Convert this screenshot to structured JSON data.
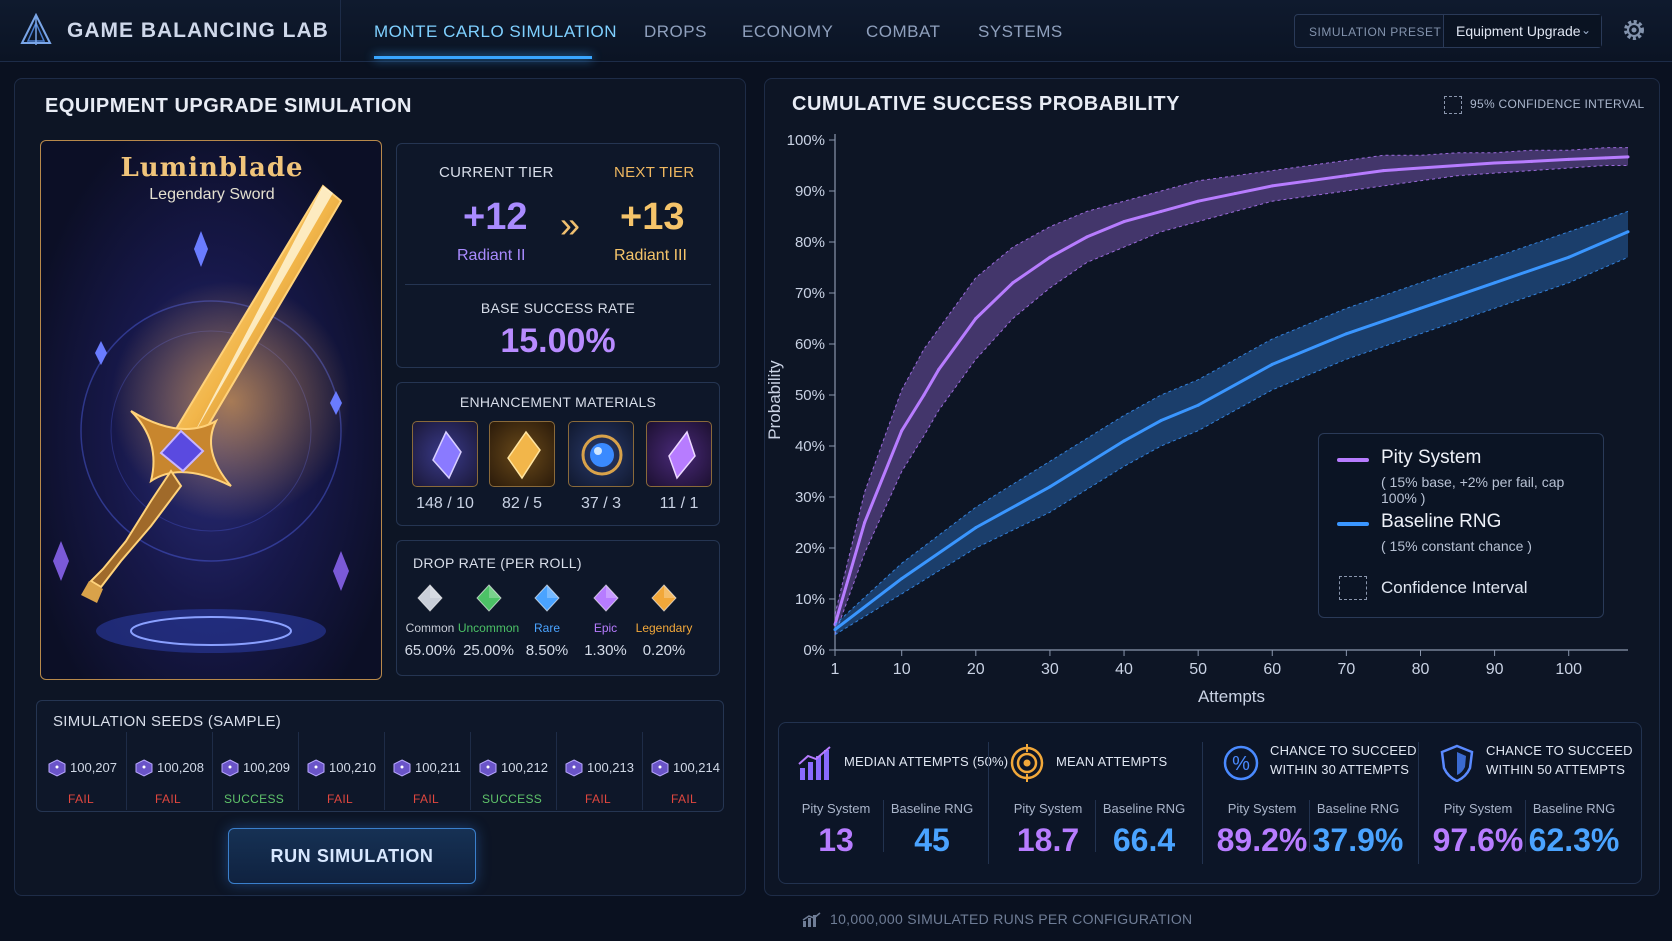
{
  "header": {
    "app_title": "GAME BALANCING LAB",
    "tabs": [
      {
        "label": "MONTE CARLO SIMULATION",
        "active": true
      },
      {
        "label": "DROPS"
      },
      {
        "label": "ECONOMY"
      },
      {
        "label": "COMBAT"
      },
      {
        "label": "SYSTEMS"
      }
    ],
    "preset_label": "SIMULATION PRESET",
    "preset_value": "Equipment Upgrade",
    "icons": [
      "logo-icon",
      "chevron-down-icon",
      "gear-icon"
    ]
  },
  "left": {
    "title": "EQUIPMENT UPGRADE SIMULATION",
    "item": {
      "name": "Luminblade",
      "subtitle": "Legendary Sword"
    },
    "tier": {
      "current_label": "CURRENT TIER",
      "current_value": "+12",
      "current_name": "Radiant II",
      "next_label": "NEXT TIER",
      "next_value": "+13",
      "next_name": "Radiant III"
    },
    "base_rate": {
      "label": "BASE SUCCESS RATE",
      "value": "15.00%"
    },
    "materials": {
      "label": "ENHANCEMENT MATERIALS",
      "items": [
        {
          "icon": "purple-crystal-icon",
          "count": "148 / 10"
        },
        {
          "icon": "gold-crystal-icon",
          "count": "82 / 5"
        },
        {
          "icon": "blue-orb-icon",
          "count": "37 / 3"
        },
        {
          "icon": "violet-crystal-icon",
          "count": "11 / 1"
        }
      ]
    },
    "drop_rates": {
      "label": "DROP RATE (PER ROLL)",
      "items": [
        {
          "name": "Common",
          "pct": "65.00%",
          "color": "#c9ced8"
        },
        {
          "name": "Uncommon",
          "pct": "25.00%",
          "color": "#4cc266"
        },
        {
          "name": "Rare",
          "pct": "8.50%",
          "color": "#4aa3ff"
        },
        {
          "name": "Epic",
          "pct": "1.30%",
          "color": "#b77cff"
        },
        {
          "name": "Legendary",
          "pct": "0.20%",
          "color": "#f2a83a"
        }
      ]
    },
    "seeds": {
      "label": "SIMULATION SEEDS (SAMPLE)",
      "items": [
        {
          "id": "100,207",
          "result": "FAIL"
        },
        {
          "id": "100,208",
          "result": "FAIL"
        },
        {
          "id": "100,209",
          "result": "SUCCESS"
        },
        {
          "id": "100,210",
          "result": "FAIL"
        },
        {
          "id": "100,211",
          "result": "FAIL"
        },
        {
          "id": "100,212",
          "result": "SUCCESS"
        },
        {
          "id": "100,213",
          "result": "FAIL"
        },
        {
          "id": "100,214",
          "result": "FAIL"
        }
      ]
    },
    "run_button": "RUN SIMULATION"
  },
  "right": {
    "ci_toggle": "95% CONFIDENCE INTERVAL",
    "legend": {
      "pity_name": "Pity System",
      "pity_desc": "( 15% base, +2% per fail, cap 100% )",
      "base_name": "Baseline RNG",
      "base_desc": "( 15% constant chance )",
      "ci_name": "Confidence Interval"
    },
    "stats": [
      {
        "icon": "bar-chart-icon",
        "title": "MEDIAN ATTEMPTS (50%)",
        "pity_label": "Pity System",
        "pity": "13",
        "base_label": "Baseline RNG",
        "base": "45"
      },
      {
        "icon": "target-icon",
        "title": "MEAN ATTEMPTS",
        "pity_label": "Pity System",
        "pity": "18.7",
        "base_label": "Baseline RNG",
        "base": "66.4"
      },
      {
        "icon": "percent-icon",
        "title": "CHANCE TO SUCCEED\nWITHIN 30 ATTEMPTS",
        "pity_label": "Pity System",
        "pity": "89.2%",
        "base_label": "Baseline RNG",
        "base": "37.9%"
      },
      {
        "icon": "shield-icon",
        "title": "CHANCE TO SUCCEED\nWITHIN 50 ATTEMPTS",
        "pity_label": "Pity System",
        "pity": "97.6%",
        "base_label": "Baseline RNG",
        "base": "62.3%"
      }
    ],
    "footer": "10,000,000 SIMULATED RUNS PER CONFIGURATION"
  },
  "chart_data": {
    "type": "line",
    "title": "CUMULATIVE SUCCESS PROBABILITY",
    "xlabel": "Attempts",
    "ylabel": "Probability",
    "xlim": [
      1,
      108
    ],
    "ylim": [
      0,
      100
    ],
    "x_ticks": [
      1,
      10,
      20,
      30,
      40,
      50,
      60,
      70,
      80,
      90,
      100
    ],
    "y_ticks": [
      "0%",
      "10%",
      "20%",
      "30%",
      "40%",
      "50%",
      "60%",
      "70%",
      "80%",
      "90%",
      "100%"
    ],
    "grid": false,
    "legend_position": "right",
    "series": [
      {
        "name": "Pity System",
        "color": "#b77cff",
        "x": [
          1,
          5,
          10,
          13,
          15,
          20,
          25,
          30,
          35,
          40,
          45,
          50,
          55,
          60,
          65,
          70,
          75,
          80,
          85,
          90,
          95,
          100,
          105,
          108
        ],
        "y": [
          5,
          25,
          43,
          50,
          55,
          65,
          72,
          77,
          81,
          84,
          86,
          88,
          89.5,
          91,
          92,
          93,
          94,
          94.5,
          95,
          95.5,
          95.8,
          96.2,
          96.5,
          96.7
        ],
        "ci_low": [
          3,
          19,
          35,
          42,
          47,
          57,
          65,
          71,
          76,
          79,
          82,
          84,
          86,
          88,
          89,
          90,
          91,
          92,
          93,
          93.5,
          94,
          94.5,
          95,
          95
        ],
        "ci_high": [
          7,
          31,
          51,
          59,
          63,
          73,
          79,
          83,
          86,
          88,
          90,
          92,
          93,
          94,
          95,
          96,
          97,
          97,
          97.5,
          97.5,
          98,
          98,
          98.5,
          98.5
        ]
      },
      {
        "name": "Baseline RNG",
        "color": "#3a96ff",
        "x": [
          1,
          10,
          20,
          30,
          40,
          45,
          50,
          60,
          70,
          80,
          90,
          100,
          108
        ],
        "y": [
          4,
          14,
          24,
          32,
          41,
          45,
          48,
          56,
          62,
          67,
          72,
          77,
          82
        ],
        "ci_low": [
          3,
          11,
          20,
          27,
          36,
          40,
          43,
          51,
          57,
          62,
          67,
          72,
          77
        ],
        "ci_high": [
          5,
          17,
          28,
          37,
          46,
          50,
          53,
          61,
          67,
          72,
          77,
          82,
          86
        ]
      }
    ]
  }
}
